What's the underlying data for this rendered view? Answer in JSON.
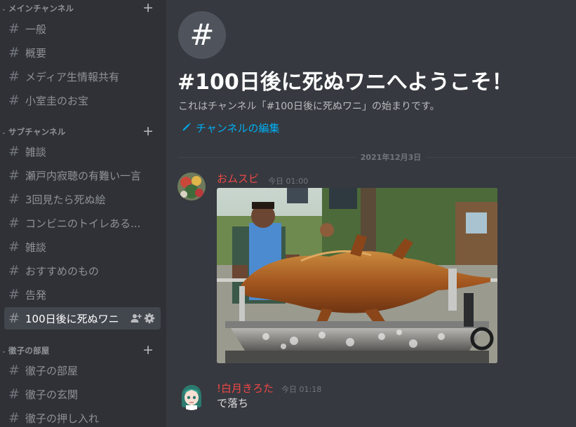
{
  "sidebar": {
    "categories": [
      {
        "label": "メインチャンネル",
        "channels": [
          "一般",
          "概要",
          "メディア生情報共有",
          "小室圭のお宝"
        ]
      },
      {
        "label": "サブチャンネル",
        "channels": [
          "雑談",
          "瀬戸内寂聴の有難い一言",
          "3回見たら死ぬ絵",
          "コンビニのトイレある...",
          "雑談",
          "おすすめのもの",
          "告発",
          "100日後に死ぬワニ"
        ]
      },
      {
        "label": "徹子の部屋",
        "channels": [
          "徹子の部屋",
          "徹子の玄関",
          "徹子の押し入れ"
        ]
      }
    ],
    "selected_channel": "100日後に死ぬワニ",
    "hash_glyph": "#",
    "plus_glyph": "+",
    "chevron_glyph": "⌄"
  },
  "main": {
    "welcome_icon": "#",
    "welcome_title": "#100日後に死ぬワニへようこそ！",
    "welcome_sub": "これはチャンネル「#100日後に死ぬワニ」の始まりです。",
    "edit_label": "チャンネルの編集",
    "date_divider": "2021年12月3日",
    "messages": [
      {
        "author": "おムスビ",
        "time": "今日 01:00",
        "attachment": "roasted-crocodile-photo"
      },
      {
        "author": "!白月きろた",
        "time": "今日 01:18",
        "text": "で落ち"
      }
    ]
  },
  "colors": {
    "sidebar_bg": "#2f3136",
    "main_bg": "#36393f",
    "selected_bg": "#42464d",
    "link": "#00aff4",
    "author": "#f04747"
  }
}
